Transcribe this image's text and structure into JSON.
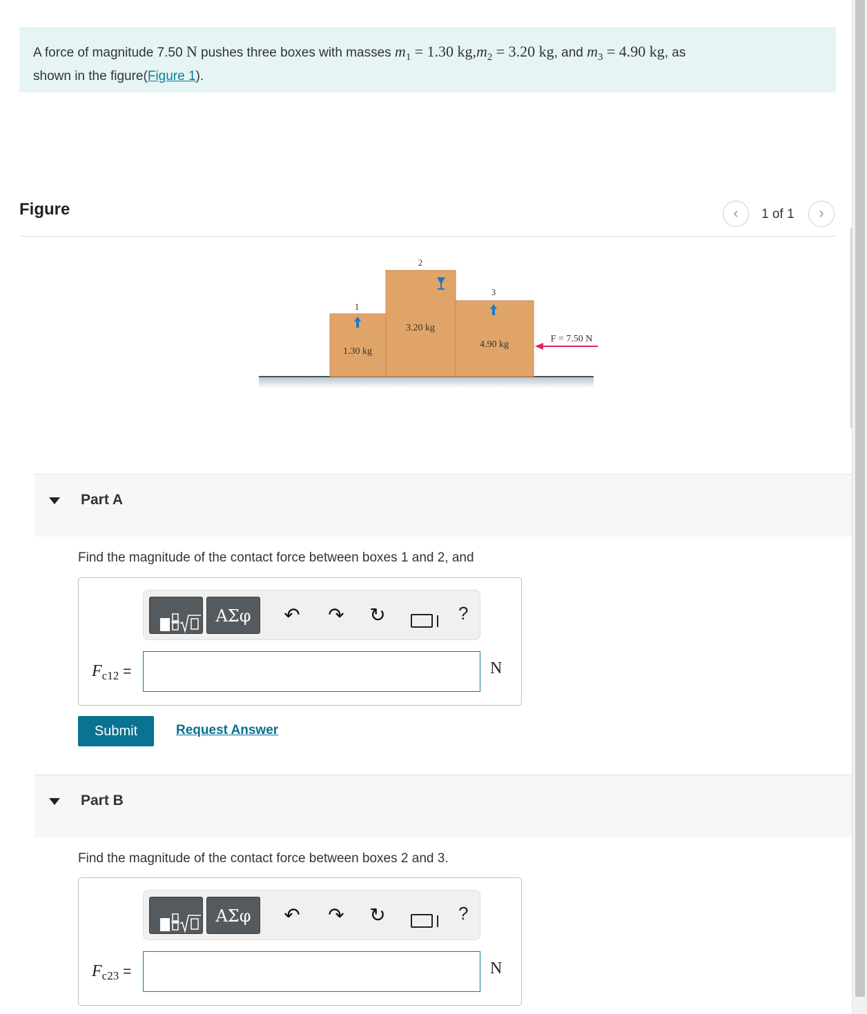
{
  "intro": {
    "text_start": "A force of magnitude 7.50",
    "force_unit": "N",
    "text_mid": "pushes three boxes with masses",
    "m1_sym": "m",
    "m1_sub": "1",
    "m1_val": "= 1.30  kg,",
    "m2_sym": "m",
    "m2_sub": "2",
    "m2_val": "= 3.20 kg",
    "comma_and": ", and",
    "m3_sym": "m",
    "m3_sub": "3",
    "m3_val": "= 4.90 kg",
    "text_as": ", as",
    "line2_start": "shown in the figure(",
    "figure_link": "Figure 1",
    "line2_end": ")."
  },
  "figure_panel": {
    "title": "Figure",
    "pager_text": "1 of 1",
    "prev_icon": "chevron-left-icon",
    "next_icon": "chevron-right-icon"
  },
  "figure": {
    "box1_number": "1",
    "box1_mass": "1.30 kg",
    "box2_number": "2",
    "box2_mass": "3.20 kg",
    "box3_number": "3",
    "box3_mass": "4.90 kg",
    "force_label": "F = 7.50 N",
    "box_color": "#e0a468",
    "arrow_color": "#e0245e"
  },
  "part_a": {
    "label": "Part A",
    "question": "Find the magnitude of the contact force between boxes 1 and 2, and",
    "var_symbol": "F",
    "var_sub": "c12",
    "equals": "=",
    "value": "",
    "unit": "N",
    "greek_label": "ΑΣφ",
    "help_label": "?"
  },
  "actions": {
    "submit_label": "Submit",
    "request_label": "Request Answer"
  },
  "part_b": {
    "label": "Part B",
    "question": "Find the magnitude of the contact force between boxes 2 and 3.",
    "var_symbol": "F",
    "var_sub": "c23",
    "equals": "=",
    "value": "",
    "unit": "N",
    "greek_label": "ΑΣφ",
    "help_label": "?"
  },
  "colors": {
    "accent": "#0a7293",
    "link": "#0d7d9c",
    "banner": "#e6f4f4"
  }
}
